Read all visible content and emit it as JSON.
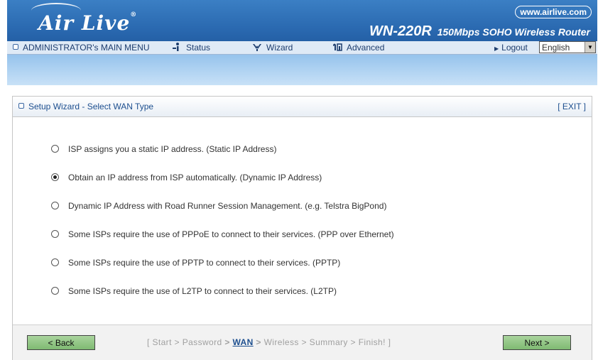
{
  "header": {
    "brand": "Air Live",
    "url": "www.airlive.com",
    "model": "WN-220R",
    "model_desc": "150Mbps SOHO Wireless Router"
  },
  "menu": {
    "main": "ADMINISTRATOR's MAIN MENU",
    "status": "Status",
    "wizard": "Wizard",
    "advanced": "Advanced",
    "logout": "Logout",
    "language": "English"
  },
  "panel": {
    "title": "Setup Wizard - Select WAN Type",
    "exit": "[ EXIT ]"
  },
  "options": [
    {
      "label": "ISP assigns you a static IP address. (Static IP Address)",
      "selected": false
    },
    {
      "label": "Obtain an IP address from ISP automatically. (Dynamic IP Address)",
      "selected": true
    },
    {
      "label": "Dynamic IP Address with Road Runner Session Management. (e.g. Telstra BigPond)",
      "selected": false
    },
    {
      "label": "Some ISPs require the use of PPPoE to connect to their services. (PPP over Ethernet)",
      "selected": false
    },
    {
      "label": "Some ISPs require the use of PPTP to connect to their services. (PPTP)",
      "selected": false
    },
    {
      "label": "Some ISPs require the use of L2TP to connect to their services. (L2TP)",
      "selected": false
    }
  ],
  "footer": {
    "back": "< Back",
    "next": "Next >",
    "steps": {
      "open": "[",
      "start": "Start",
      "sep": ">",
      "password": "Password",
      "wan": "WAN",
      "wireless": "Wireless",
      "summary": "Summary",
      "finish": "Finish!",
      "close": "]"
    }
  }
}
